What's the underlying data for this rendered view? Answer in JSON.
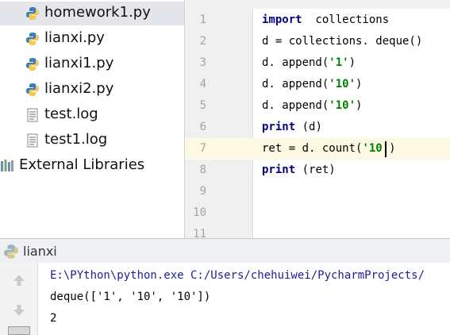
{
  "project_tree": {
    "items": [
      {
        "label": "homework1.py",
        "icon": "python-file-icon",
        "selected": true
      },
      {
        "label": "lianxi.py",
        "icon": "python-file-icon"
      },
      {
        "label": "lianxi1.py",
        "icon": "python-file-icon"
      },
      {
        "label": "lianxi2.py",
        "icon": "python-file-icon"
      },
      {
        "label": "test.log",
        "icon": "text-file-icon"
      },
      {
        "label": "test1.log",
        "icon": "text-file-icon"
      },
      {
        "label": "External Libraries",
        "icon": "libraries-icon"
      }
    ]
  },
  "editor": {
    "line_numbers": [
      "1",
      "2",
      "3",
      "4",
      "5",
      "6",
      "7",
      "8",
      "9",
      "10",
      "11"
    ],
    "current_line": "7",
    "lines": [
      {
        "kw": "import",
        "rest": "  collections"
      },
      {
        "text": "d = collections. deque()"
      },
      {
        "pre": "d. append(",
        "str": "'1'",
        "post": ")"
      },
      {
        "pre": "d. append(",
        "str": "'10'",
        "post": ")"
      },
      {
        "pre": "d. append(",
        "str": "'10'",
        "post": ")"
      },
      {
        "kw": "print",
        "rest": " (d)"
      },
      {
        "pre": "ret = d. count(",
        "str": "'10",
        "post": "')"
      },
      {
        "kw": "print",
        "rest": " (ret)"
      }
    ]
  },
  "run_panel": {
    "title": "lianxi",
    "icon": "python-run-icon",
    "toolbar": [
      "rerun-up-icon",
      "rerun-down-icon"
    ],
    "output": [
      "E:\\PYthon\\python.exe C:/Users/chehuiwei/PycharmProjects/",
      "deque(['1', '10', '10'])",
      "2"
    ]
  },
  "colors": {
    "keyword": "#000080",
    "string": "#008000",
    "selection": "#e4e6eb",
    "current_line": "#fdf9e3"
  }
}
